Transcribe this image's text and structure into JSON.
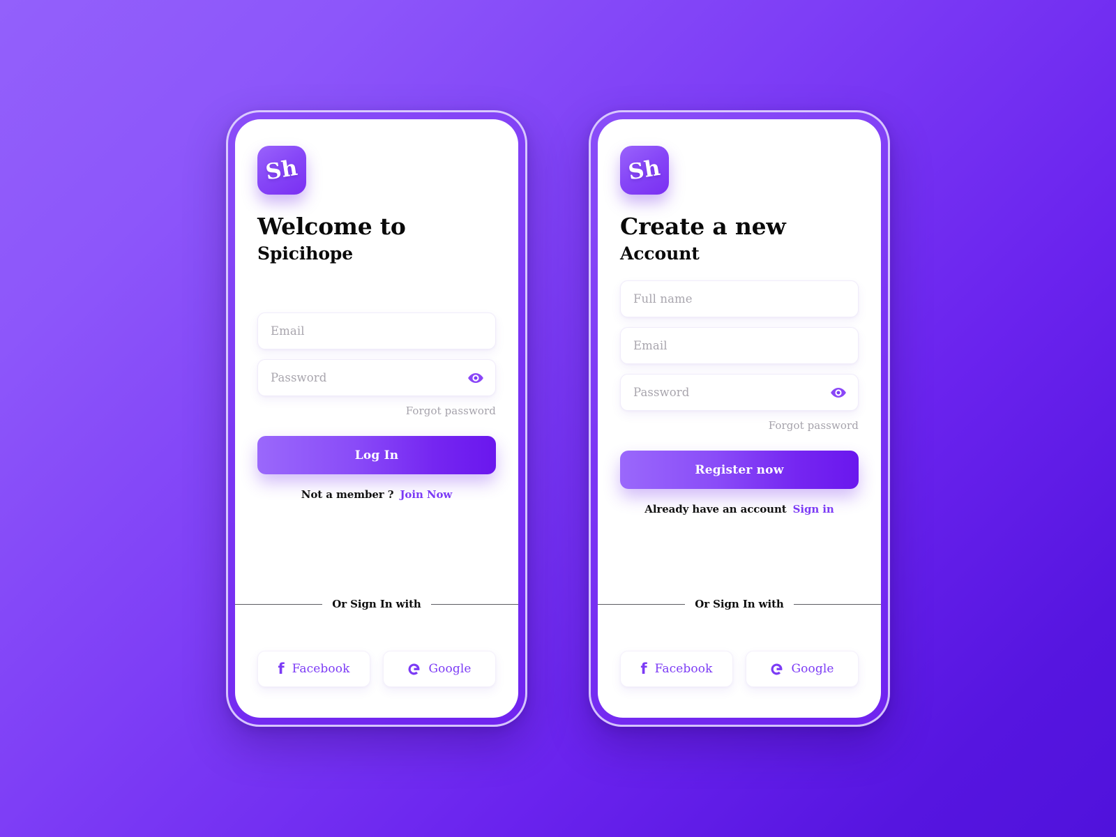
{
  "theme": {
    "bg_gradient_start": "#9360fb",
    "bg_gradient_end": "#5012dc",
    "accent": "#7c3bf5",
    "button_gradient_start": "#9a68fb",
    "button_gradient_end": "#6a17ee",
    "placeholder_color": "#a8a5ad"
  },
  "login_screen": {
    "logo_text": "Sh",
    "title_line_1": "Welcome to",
    "title_line_2": "Spicihope",
    "fields": [
      {
        "name": "email",
        "placeholder": "Email",
        "value": "",
        "has_eye_toggle": false
      },
      {
        "name": "password",
        "placeholder": "Password",
        "value": "",
        "has_eye_toggle": true
      }
    ],
    "forgot_password_label": "Forgot password",
    "primary_button_label": "Log In",
    "footer_prompt": "Not a member ?",
    "footer_link": "Join Now",
    "divider_label": "Or Sign In with",
    "social_buttons": [
      {
        "icon": "facebook-icon",
        "label": "Facebook"
      },
      {
        "icon": "google-icon",
        "label": "Google"
      }
    ]
  },
  "signup_screen": {
    "logo_text": "Sh",
    "title_line_1": "Create a new",
    "title_line_2": "Account",
    "fields": [
      {
        "name": "full-name",
        "placeholder": "Full name",
        "value": "",
        "has_eye_toggle": false
      },
      {
        "name": "email",
        "placeholder": "Email",
        "value": "",
        "has_eye_toggle": false
      },
      {
        "name": "password",
        "placeholder": "Password",
        "value": "",
        "has_eye_toggle": true
      }
    ],
    "forgot_password_label": "Forgot password",
    "primary_button_label": "Register now",
    "footer_prompt": "Already have an account",
    "footer_link": "Sign in",
    "divider_label": "Or Sign In with",
    "social_buttons": [
      {
        "icon": "facebook-icon",
        "label": "Facebook"
      },
      {
        "icon": "google-icon",
        "label": "Google"
      }
    ]
  }
}
